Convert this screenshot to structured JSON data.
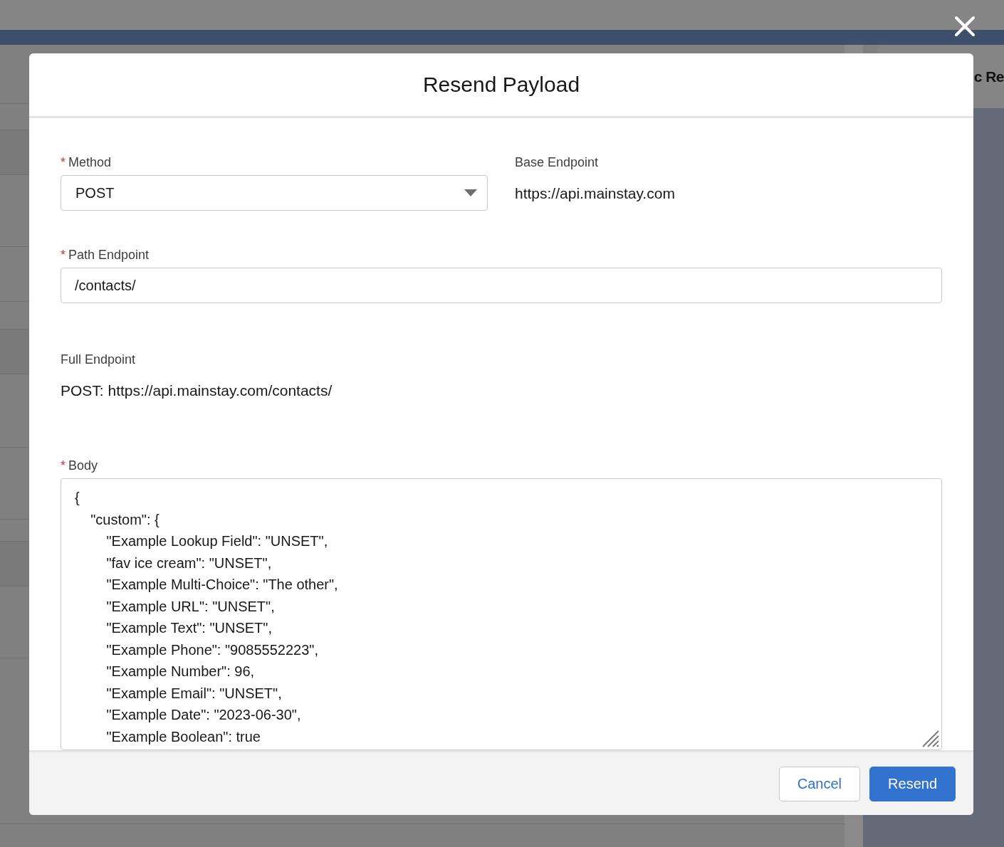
{
  "background_card": {
    "title": "c Re"
  },
  "dialog": {
    "title": "Resend Payload",
    "method": {
      "label": "Method",
      "required_mark": "*",
      "value": "POST"
    },
    "base_endpoint": {
      "label": "Base Endpoint",
      "value": "https://api.mainstay.com"
    },
    "path_endpoint": {
      "label": "Path Endpoint",
      "required_mark": "*",
      "value": "/contacts/"
    },
    "full_endpoint": {
      "label": "Full Endpoint",
      "value": "POST: https://api.mainstay.com/contacts/"
    },
    "body": {
      "label": "Body",
      "required_mark": "*",
      "lines": [
        "{",
        "    \"custom\": {",
        "        \"Example Lookup Field\": \"UNSET\",",
        "        \"fav ice cream\": \"UNSET\",",
        "        \"Example Multi-Choice\": \"The other\",",
        "        \"Example URL\": \"UNSET\",",
        "        \"Example Text\": \"UNSET\",",
        "        \"Example Phone\": \"9085552223\",",
        "        \"Example Number\": 96,",
        "        \"Example Email\": \"UNSET\",",
        "        \"Example Date\": \"2023-06-30\",",
        "        \"Example Boolean\": true"
      ]
    },
    "buttons": [
      {
        "label": "Cancel",
        "kind": "neutral"
      },
      {
        "label": "Resend",
        "kind": "brand"
      }
    ]
  }
}
